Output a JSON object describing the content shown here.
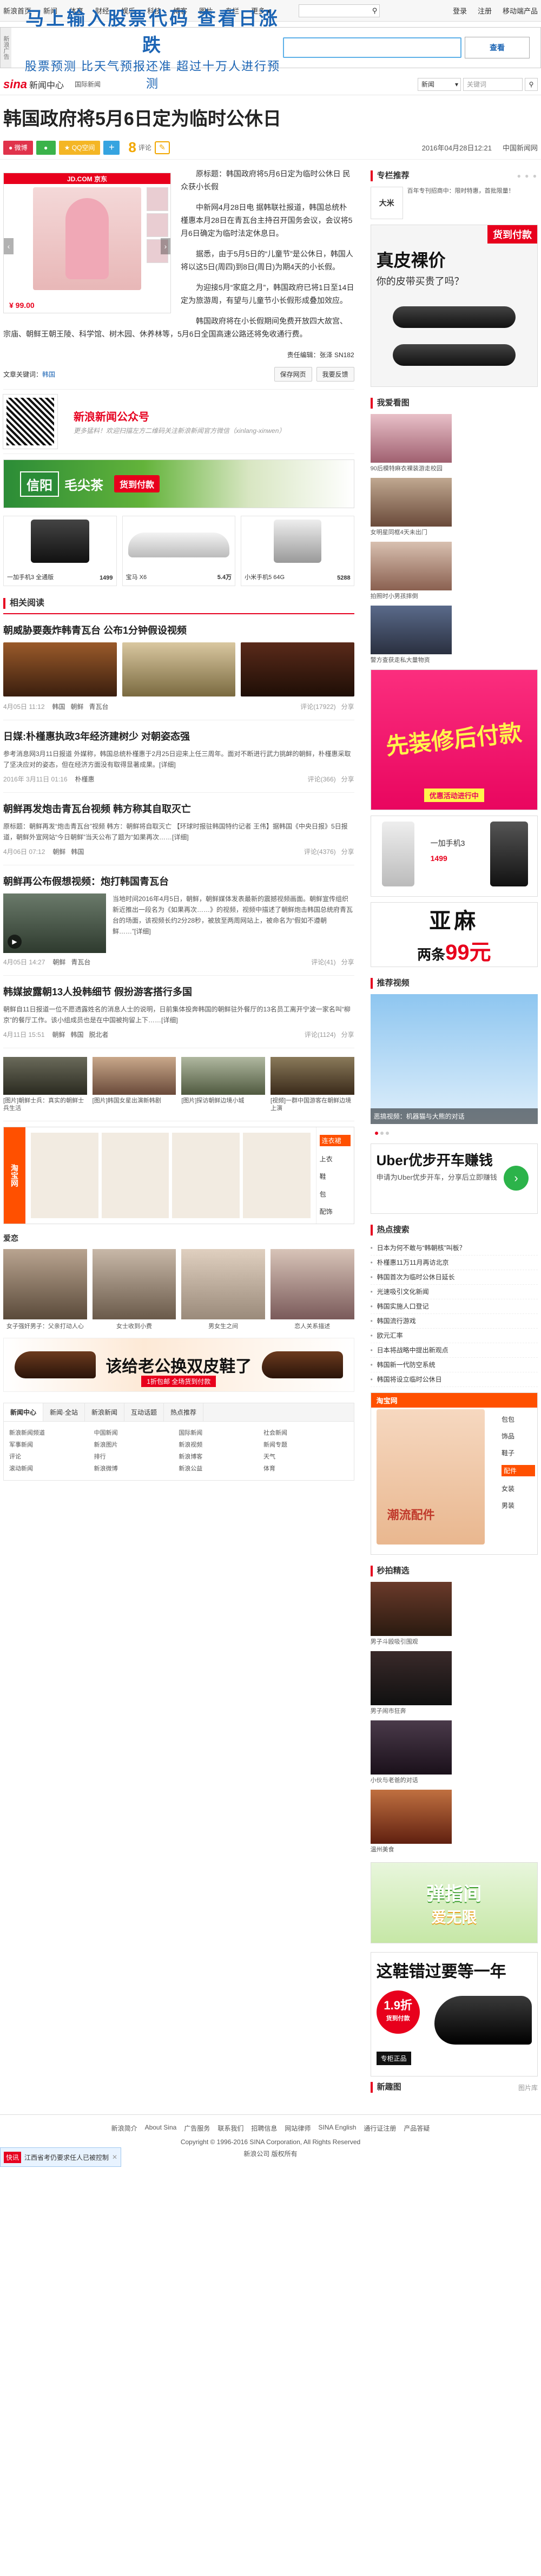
{
  "topnav": {
    "items": [
      "新浪首页",
      "新闻",
      "体育",
      "财经",
      "娱乐",
      "科技",
      "博客",
      "图片",
      "专栏",
      "更多"
    ],
    "right": [
      "登录",
      "注册",
      "移动端产品"
    ]
  },
  "ad_top": {
    "label": "新浪广告",
    "headline": "马上输入股票代码  查看日涨跌",
    "sub": "股票预测 比天气预报还准 超过十万人进行预测",
    "button": "查看"
  },
  "logobar": {
    "logo": "sina",
    "logo_sub": "新闻中心",
    "crumb": "国际新闻",
    "select": "新闻",
    "search_placeholder": "关键词"
  },
  "article": {
    "title": "韩国政府将5月6日定为临时公休日",
    "share": {
      "weibo": "微博",
      "wechat": "",
      "qzone": "QQ空间",
      "plus": "+"
    },
    "comment_count": "8",
    "comment_label": "评论",
    "date": "2016年04月28日12:21",
    "source": "中国新闻网",
    "ad": {
      "head": "JD.COM 京东",
      "price": "¥ 99.00"
    },
    "paragraphs": [
      "原标题：韩国政府将5月6日定为临时公休日 民众获小长假",
      "中新网4月28日电 据韩联社报道，韩国总统朴槿惠本月28日在青瓦台主持召开国务会议，会议将5月6日确定为临时法定休息日。",
      "据悉，由于5月5日的“儿童节”是公休日，韩国人将以这5日(周四)到8日(周日)为期4天的小长假。",
      "为迎接5月“家庭之月”，韩国政府已将1日至14日定为旅游周，有望与儿童节小长假形成叠加效应。",
      "韩国政府将在小长假期间免费开放四大故宫、宗庙、朝鲜王朝王陵、科学馆、树木园、休养林等，5月6日全国高速公路还将免收通行费。"
    ],
    "editor": "责任编辑：张泽 SN182",
    "keyword_label": "文章关键词：",
    "keyword": "韩国",
    "buttons": [
      "保存网页",
      "我要反馈"
    ]
  },
  "qr": {
    "title": "新浪新闻公众号",
    "desc": "更多猛料！欢迎扫描左方二维码关注新浪新闻官方微信（xinlang-xinwen）"
  },
  "tea_banner": {
    "brand": "信阳",
    "name": "毛尖茶",
    "tag": "货到付款"
  },
  "products": [
    {
      "name": "一加手机3 全通版",
      "price": "1499"
    },
    {
      "name": "宝马 X6",
      "price": "5.4万"
    },
    {
      "name": "小米手机5 64G",
      "price": "5288"
    }
  ],
  "related": {
    "title": "相关阅读",
    "news": [
      {
        "title": "朝威胁要轰炸韩青瓦台 公布1分钟假设视频",
        "time": "4月05日 11:12",
        "tags": [
          "韩国",
          "朝鲜",
          "青瓦台"
        ],
        "comments": "评论(17922)",
        "share": "分享"
      },
      {
        "title": "日媒:朴槿惠执政3年经济建树少 对朝姿态强",
        "desc": "参考消息网3月11日报道 外媒称，韩国总统朴槿惠于2月25日迎来上任三周年。面对不断进行武力挑衅的朝鲜，朴槿惠采取了坚决应对的姿态，但在经济方面没有取得显著成果。[详细]",
        "time": "2016年 3月11日 01:16",
        "tags": [
          "朴槿惠"
        ],
        "comments": "评论(366)",
        "share": "分享"
      },
      {
        "title": "朝鲜再发炮击青瓦台视频 韩方称其自取灭亡",
        "desc": "原标题：朝鲜再发“炮击青瓦台”视频 韩方：朝鲜将自取灭亡 【环球时报驻韩国特约记者 王伟】据韩国《中央日报》5日报道，朝鲜外宣网站“今日朝鲜”当天公布了题为“如果再次……[详细]",
        "time": "4月06日 07:12",
        "tags": [
          "朝鲜",
          "韩国"
        ],
        "comments": "评论(4376)",
        "share": "分享"
      },
      {
        "title": "朝鲜再公布假想视频：炮打韩国青瓦台",
        "desc": "当地时间2016年4月5日，朝鲜，朝鲜媒体发表最新的震撼视频画面。朝鲜宣传组织新近推出一段名为《如果再次……》的视频，视频中描述了朝鲜炮击韩国总统府青瓦台的场面，该视频长约2分28秒，被放至两周网站上，被命名为“假如不遵朝鲜……”[详细]",
        "time": "4月05日 14:27",
        "tags": [
          "朝鲜",
          "青瓦台"
        ],
        "comments": "评论(41)",
        "share": "分享"
      },
      {
        "title": "韩媒披露朝13人投韩细节 假扮游客搭行多国",
        "desc": "朝鲜自11日报道一位不愿透露姓名的消息人士的说明，日前集体投奔韩国的朝鲜驻外餐厅的13名员工离开宁波一家名叫“柳京”的餐厅工作。该小组成员也是在中国被拘留上下……[详细]",
        "time": "4月11日 15:51",
        "tags": [
          "朝鲜",
          "韩国",
          "脱北者"
        ],
        "comments": "评论(1124)",
        "share": "分享"
      }
    ],
    "pics": [
      {
        "caption": "[图片]朝鲜士兵：真实的朝鲜士兵生活"
      },
      {
        "caption": "[图片]韩国女星出演新韩剧"
      },
      {
        "caption": "[图片]探访朝鲜边境小城"
      },
      {
        "caption": "[视频]一群中国游客在朝鲜边境上演"
      }
    ]
  },
  "taobao": {
    "logo": "淘宝网",
    "menu": [
      "连衣裙",
      "上衣",
      "鞋",
      "包",
      "配饰"
    ]
  },
  "love": {
    "title": "爱恋",
    "items": [
      {
        "caption": "女子强奸男子：父亲打动人心"
      },
      {
        "caption": "女士收到小费"
      },
      {
        "caption": "男女生之间"
      },
      {
        "caption": "恋人关系描述"
      }
    ],
    "shoe_banner": "该给老公换双皮鞋了",
    "shoe_sub": "1折包邮 全场货到付款"
  },
  "nav_table": {
    "tabs": [
      "新闻中心",
      "新闻·全站",
      "新浪新闻",
      "互动话题",
      "热点推荐"
    ],
    "cells": [
      "新浪新闻频道",
      "中国新闻",
      "国际新闻",
      "社会新闻",
      "军事新闻",
      "新浪图片",
      "新浪视频",
      "新闻专题",
      "评论",
      "排行",
      "新浪博客",
      "天气",
      "滚动新闻",
      "新浪微博",
      "新浪公益",
      "体育"
    ]
  },
  "sidebar": {
    "recommend_title": "专栏推荐",
    "recommend_ad": {
      "logo": "大米",
      "text": "百年专刊招商中：限时特惠，首批限量！",
      "highlight": "大米"
    },
    "belt_ad": {
      "head": "货到付款",
      "big": "真皮裸价",
      "question": "你的皮带买贵了吗？"
    },
    "watch_title": "我爱看图",
    "watch": [
      {
        "caption": "90后模特麻衣裸装游走校园"
      },
      {
        "caption": "女明星同框4天未出门"
      },
      {
        "caption": "拍照时小男孩摔倒"
      },
      {
        "caption": "警方查获走私大量物资"
      }
    ],
    "pink_ad": {
      "text": "先装修后付款",
      "sub": "优惠活动进行中"
    },
    "phone_ad": {
      "name": "一加手机3",
      "price": "1499"
    },
    "linen_ad": {
      "t1": "亚麻",
      "t2": "两条",
      "price": "99元"
    },
    "video_title": "推荐视频",
    "video_caption": "恶搞视频：机器猫与大熊的对话",
    "uber": {
      "t1": "Uber优步开车赚钱",
      "t2": "申请为Uber优步开车，分享后立即赚钱"
    },
    "hot_title": "热点搜索",
    "hot_list": [
      "日本为何不敢与“韩朝核”叫板？",
      "朴槿惠11万11月再访北京",
      "韩国首次为临时公休日延长",
      "光速吸引文化新闻",
      "韩国实施人口登记",
      "韩国流行游戏",
      "欧元汇率",
      "日本将战略中提出新观点",
      "韩国新一代防空系统",
      "韩国将设立临时公休日"
    ],
    "taobao_side": {
      "head": "淘宝网",
      "label": "潮流配件",
      "menu": [
        "包包",
        "饰品",
        "鞋子",
        "配件",
        "女装",
        "男装"
      ]
    },
    "seckill_title": "秒拍精选",
    "seckill": [
      {
        "caption": "男子斗殴吸引围观"
      },
      {
        "caption": "男子闹市狂奔"
      },
      {
        "caption": "小伙与老爸的对话"
      },
      {
        "caption": "温州美食"
      }
    ],
    "green_ad": {
      "t1": "弹指间",
      "t2": "爱无限"
    },
    "shoe_ad": {
      "title": "这鞋错过要等一年",
      "price": "1.9折",
      "price_sub": "货到付款",
      "badge": "专柜正品"
    },
    "new_pics_title": "新趣图",
    "new_pics_more": "图片库"
  },
  "footer": {
    "links": [
      "新浪简介",
      "About Sina",
      "广告服务",
      "联系我们",
      "招聘信息",
      "网站律师",
      "SINA English",
      "通行证注册",
      "产品答疑"
    ],
    "copy": "Copyright © 1996-2016 SINA Corporation, All Rights Reserved",
    "copy2": "新浪公司 版权所有",
    "float_label": "快讯",
    "float_text": "江西省考仍要求任人已被控制"
  }
}
